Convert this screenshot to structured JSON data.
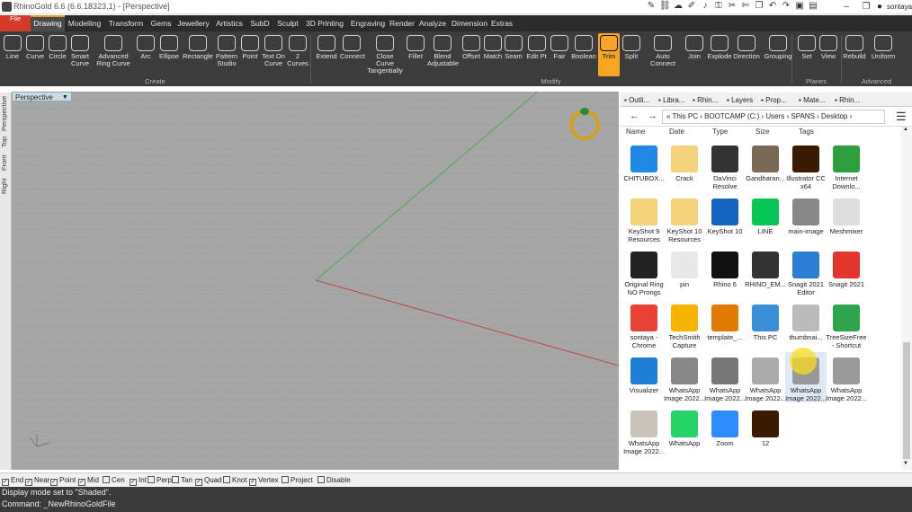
{
  "window": {
    "title": "RhinoGold 6.6 (6.6.18323.1) - [Perspective]",
    "user": "sontaya"
  },
  "tabs": [
    "File",
    "Drawing",
    "Modelling",
    "Transform",
    "Gems",
    "Jewellery",
    "Artistics",
    "SubD",
    "Sculpt",
    "3D Printing",
    "Engraving",
    "Render",
    "Analyze",
    "Dimension",
    "Extras"
  ],
  "active_tab": "Drawing",
  "ribbon": {
    "buttons": [
      "Line",
      "Curve",
      "Circle",
      "Smart Curve",
      "Advanced Ring Curve",
      "Arc",
      "Ellipse",
      "Rectangle",
      "Pattern Studio",
      "Point",
      "Text On Curve",
      "2 Curves",
      "Extend",
      "Connect",
      "Close Curve Tangentially",
      "Fillet",
      "Blend Adjustable",
      "Offset",
      "Match",
      "Seam",
      "Edit Pt",
      "Fair",
      "Boolean",
      "Trim",
      "Split",
      "Auto Connect",
      "Join",
      "Explode",
      "Direction",
      "Grouping",
      "Set",
      "View",
      "Rebuild",
      "Uniform"
    ],
    "selected": "Trim",
    "groups": [
      "Create",
      "Modify",
      "Planes",
      "Advanced"
    ]
  },
  "viewport": {
    "label": "Perspective",
    "side_tabs": [
      "Perspective",
      "Top",
      "Front",
      "Right"
    ]
  },
  "panel_tabs": [
    "Outli...",
    "Libra...",
    "Rhin...",
    "Layers",
    "Prop...",
    "Mate...",
    "Rhin..."
  ],
  "explorer": {
    "path": "« This PC › BOOTCAMP (C:) › Users › SPANS › Desktop ›",
    "columns": [
      "Name",
      "Date",
      "Type",
      "Size",
      "Tags"
    ],
    "files": [
      {
        "name": "CHITUBOX...",
        "color": "#1e88e5"
      },
      {
        "name": "Crack",
        "color": "#f3d27a"
      },
      {
        "name": "DaVinci Resolve",
        "color": "#333"
      },
      {
        "name": "Gandharan...",
        "color": "#7a6a55"
      },
      {
        "name": "Illustrator CC x64",
        "color": "#3a1a00"
      },
      {
        "name": "Internet Downlo...",
        "color": "#2e9e3e"
      },
      {
        "name": "KeyShot 9 Resources",
        "color": "#f3d27a"
      },
      {
        "name": "KeyShot 10 Resources",
        "color": "#f3d27a"
      },
      {
        "name": "KeyShot 10",
        "color": "#1565c0"
      },
      {
        "name": "LINE",
        "color": "#06c755"
      },
      {
        "name": "main-image",
        "color": "#888"
      },
      {
        "name": "Meshmixer",
        "color": "#ddd"
      },
      {
        "name": "Original Ring NO Prongs",
        "color": "#222"
      },
      {
        "name": "pin",
        "color": "#e8e8e8"
      },
      {
        "name": "Rhino 6",
        "color": "#111"
      },
      {
        "name": "RHINO_EM...",
        "color": "#333"
      },
      {
        "name": "Snagit 2021 Editor",
        "color": "#2a7fd4"
      },
      {
        "name": "Snagit 2021",
        "color": "#e2352c"
      },
      {
        "name": "sontaya - Chrome",
        "color": "#e94235"
      },
      {
        "name": "TechSmith Capture",
        "color": "#f6b400"
      },
      {
        "name": "template_...",
        "color": "#e07b00"
      },
      {
        "name": "This PC",
        "color": "#3b8fd6"
      },
      {
        "name": "thumbnai...",
        "color": "#bbb"
      },
      {
        "name": "TreeSizeFree - Shortcut",
        "color": "#2ea44f"
      },
      {
        "name": "Visualizer",
        "color": "#1e7fd6"
      },
      {
        "name": "WhatsApp Image 2022...",
        "color": "#888"
      },
      {
        "name": "WhatsApp Image 2022...",
        "color": "#777"
      },
      {
        "name": "WhatsApp Image 2022...",
        "color": "#aaa"
      },
      {
        "name": "WhatsApp Image 2022...",
        "color": "#999"
      },
      {
        "name": "WhatsApp Image 2022...",
        "color": "#9a9a9a"
      },
      {
        "name": "WhatsApp Image 2022...",
        "color": "#c9c2b8"
      },
      {
        "name": "WhatsApp",
        "color": "#25d366"
      },
      {
        "name": "Zoom",
        "color": "#2d8cff"
      },
      {
        "name": "12",
        "color": "#3a1a00"
      }
    ]
  },
  "snaps": [
    {
      "label": "End",
      "checked": true
    },
    {
      "label": "Near",
      "checked": true
    },
    {
      "label": "Point",
      "checked": true
    },
    {
      "label": "Mid",
      "checked": true
    },
    {
      "label": "Cen",
      "checked": false
    },
    {
      "label": "Int",
      "checked": true
    },
    {
      "label": "Perp",
      "checked": false
    },
    {
      "label": "Tan",
      "checked": false
    },
    {
      "label": "Quad",
      "checked": true
    },
    {
      "label": "Knot",
      "checked": false
    },
    {
      "label": "Vertex",
      "checked": true
    },
    {
      "label": "Project",
      "checked": false
    },
    {
      "label": "Disable",
      "checked": false
    }
  ],
  "command": {
    "history": "Display mode set to \"Shaded\".",
    "prompt": "Command: _NewRhinoGoldFile"
  },
  "colors": {
    "accent": "#f6a623",
    "file_tab": "#d43a2a",
    "ribbon_bg": "#3c3c3c",
    "viewport_bg": "#a4a4a4"
  }
}
